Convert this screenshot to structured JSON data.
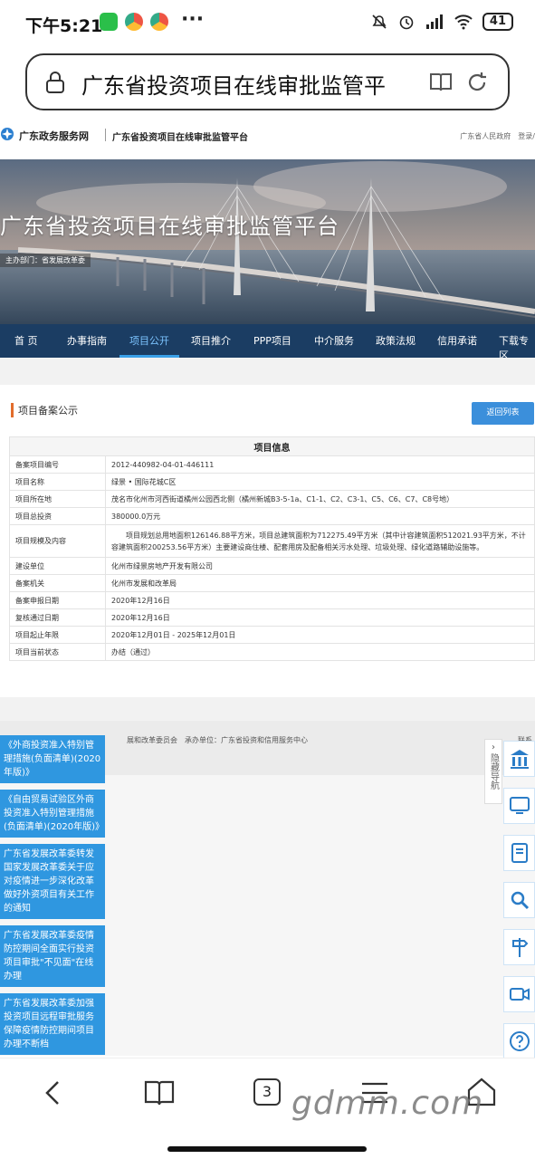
{
  "status": {
    "time": "下午5:21",
    "battery": "41",
    "more": "···"
  },
  "browser": {
    "url_title": "广东省投资项目在线审批监管平",
    "tab_count": "3",
    "watermark": "gdmm.com"
  },
  "site": {
    "gov_name": "广东政务服务网",
    "platform_name": "广东省投资项目在线审批监管平台",
    "header_links": [
      "广东省人民政府",
      "登录/"
    ]
  },
  "banner": {
    "title": "广东省投资项目在线审批监管平台",
    "subtitle": "主办部门：省发展改革委"
  },
  "nav": {
    "items": [
      "首 页",
      "办事指南",
      "项目公开",
      "项目推介",
      "PPP项目",
      "中介服务",
      "政策法规",
      "信用承诺",
      "下载专区"
    ],
    "active": "项目公开"
  },
  "section": {
    "title": "项目备案公示",
    "back_button": "返回列表"
  },
  "table": {
    "header": "项目信息",
    "rows": [
      {
        "key": "备案项目编号",
        "value": "2012-440982-04-01-446111"
      },
      {
        "key": "项目名称",
        "value": "绿景 • 国际花城C区"
      },
      {
        "key": "项目所在地",
        "value": "茂名市化州市河西街道橘州公园西北侧（橘州新城B3-5-1a、C1-1、C2、C3-1、C5、C6、C7、C8号地）"
      },
      {
        "key": "项目总投资",
        "value": "380000.0万元"
      },
      {
        "key": "项目规模及内容",
        "value": "项目规划总用地面积126146.88平方米，项目总建筑面积为712275.49平方米（其中计容建筑面积512021.93平方米，不计容建筑面积200253.56平方米）主要建设商住楼、配套用房及配备相关污水处理、垃圾处理、绿化道路辅助设施等。"
      },
      {
        "key": "建设单位",
        "value": "化州市绿景房地产开发有限公司"
      },
      {
        "key": "备案机关",
        "value": "化州市发展和改革局"
      },
      {
        "key": "备案申报日期",
        "value": "2020年12月16日"
      },
      {
        "key": "复核通过日期",
        "value": "2020年12月16日"
      },
      {
        "key": "项目起止年限",
        "value": "2020年12月01日 - 2025年12月01日"
      },
      {
        "key": "项目当前状态",
        "value": "办结（通过）"
      }
    ]
  },
  "footer": {
    "text": "展和改革委员会　承办单位：广东省投资和信用服务中心",
    "right": "联系"
  },
  "side_list": [
    "《外商投资准入特别管理措施(负面清单)(2020年版)》",
    "《自由贸易试验区外商投资准入特别管理措施(负面清单)(2020年版)》",
    "广东省发展改革委转发国家发展改革委关于应对疫情进一步深化改革做好外资项目有关工作的通知",
    "广东省发展改革委疫情防控期间全面实行投资项目审批\"不见面\"在线办理",
    "广东省发展改革委加强投资项目远程审批服务保障疫情防控期间项目办理不断档"
  ],
  "hide_nav": "隐藏导航"
}
